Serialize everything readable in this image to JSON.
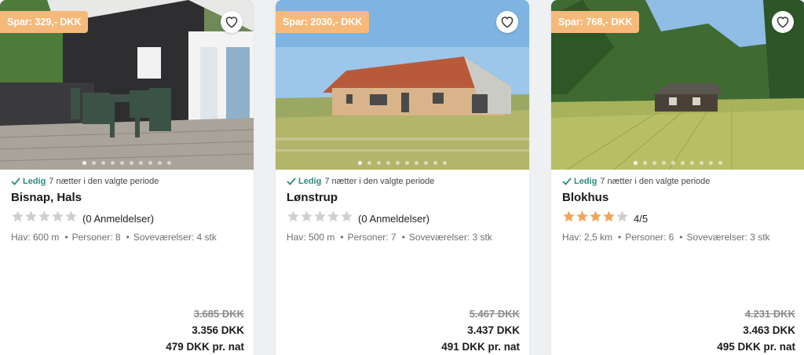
{
  "colors": {
    "badge": "#f7b97a",
    "available": "#2a8c80",
    "star_filled": "#f2a65a",
    "star_empty": "#cfcfcf"
  },
  "cards": [
    {
      "badge": "Spar: 329,- DKK",
      "available_label": "Ledig",
      "available_text": "7 nætter i den valgte periode",
      "name": "Bisnap, Hals",
      "rating_stars": 0,
      "rating_text": "(0 Anmeldelser)",
      "facts": [
        "Hav: 600 m",
        "Personer: 8",
        "Soveværelser: 4 stk"
      ],
      "price_old": "3.685 DKK",
      "price_now": "3.356 DKK",
      "price_night": "479 DKK pr. nat",
      "gallery_dots": 10,
      "gallery_active": 0
    },
    {
      "badge": "Spar: 2030,- DKK",
      "available_label": "Ledig",
      "available_text": "7 nætter i den valgte periode",
      "name": "Lønstrup",
      "rating_stars": 0,
      "rating_text": "(0 Anmeldelser)",
      "facts": [
        "Hav: 500 m",
        "Personer: 7",
        "Soveværelser: 3 stk"
      ],
      "price_old": "5.467 DKK",
      "price_now": "3.437 DKK",
      "price_night": "491 DKK pr. nat",
      "gallery_dots": 10,
      "gallery_active": 0
    },
    {
      "badge": "Spar: 768,- DKK",
      "available_label": "Ledig",
      "available_text": "7 nætter i den valgte periode",
      "name": "Blokhus",
      "rating_stars": 4,
      "rating_text": "4/5",
      "facts": [
        "Hav: 2,5 km",
        "Personer: 6",
        "Soveværelser: 3 stk"
      ],
      "price_old": "4.231 DKK",
      "price_now": "3.463 DKK",
      "price_night": "495 DKK pr. nat",
      "gallery_dots": 10,
      "gallery_active": 0
    }
  ]
}
